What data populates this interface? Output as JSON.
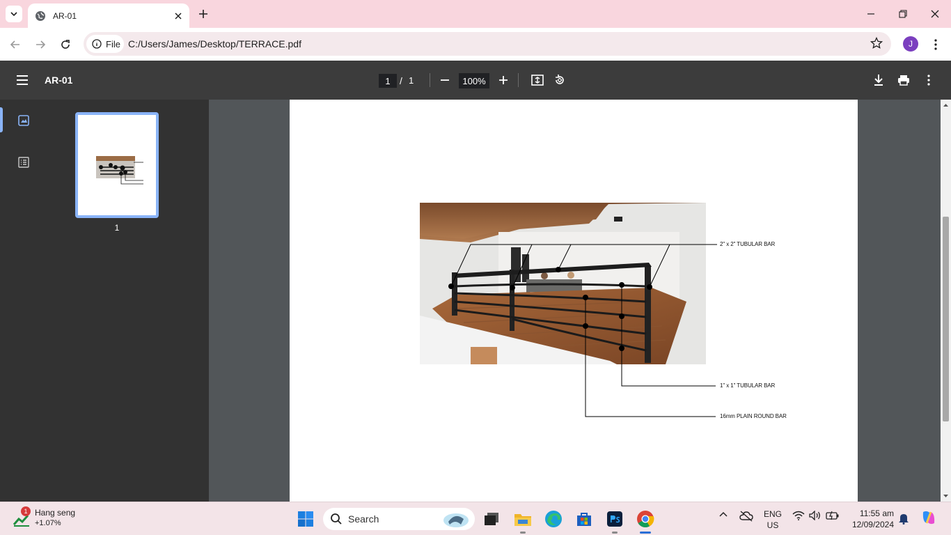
{
  "browser": {
    "tab_title": "AR-01",
    "site_chip_label": "File",
    "url": "C:/Users/James/Desktop/TERRACE.pdf",
    "profile_initial": "J",
    "profile_color": "#7b3fbf"
  },
  "pdf_viewer": {
    "title": "AR-01",
    "current_page": "1",
    "page_separator": "/",
    "total_pages": "1",
    "zoom": "100%",
    "thumbnail_page_number": "1"
  },
  "drawing": {
    "callouts": [
      "2\" x 2\" TUBULAR BAR",
      "1\" x 1\" TUBULAR BAR",
      "16mm PLAIN ROUND BAR"
    ]
  },
  "taskbar": {
    "widget_badge": "1",
    "widget_name": "Hang seng",
    "widget_value": "+1.07%",
    "search_label": "Search",
    "language_line1": "ENG",
    "language_line2": "US",
    "time": "11:55 am",
    "date": "12/09/2024"
  },
  "colors": {
    "tabbar_bg": "#f9d6de",
    "pdf_toolbar_bg": "#3c3c3c",
    "sidebar_bg": "#323232",
    "viewer_bg": "#525659",
    "accent": "#8ab4f8"
  },
  "icons": [
    "tab-list-icon",
    "globe-icon",
    "close-icon",
    "plus-icon",
    "minimize-icon",
    "restore-icon",
    "back-icon",
    "forward-icon",
    "reload-icon",
    "info-icon",
    "star-icon",
    "more-vert-icon",
    "hamburger-icon",
    "zoom-out-icon",
    "zoom-in-icon",
    "fit-page-icon",
    "rotate-icon",
    "download-icon",
    "print-icon",
    "thumbnails-icon",
    "outline-icon",
    "windows-start-icon",
    "search-icon",
    "task-view-icon",
    "file-explorer-icon",
    "edge-icon",
    "store-icon",
    "photoshop-icon",
    "chrome-icon",
    "chevron-up-icon",
    "cloud-off-icon",
    "wifi-icon",
    "volume-icon",
    "battery-icon",
    "bell-icon",
    "copilot-icon"
  ]
}
